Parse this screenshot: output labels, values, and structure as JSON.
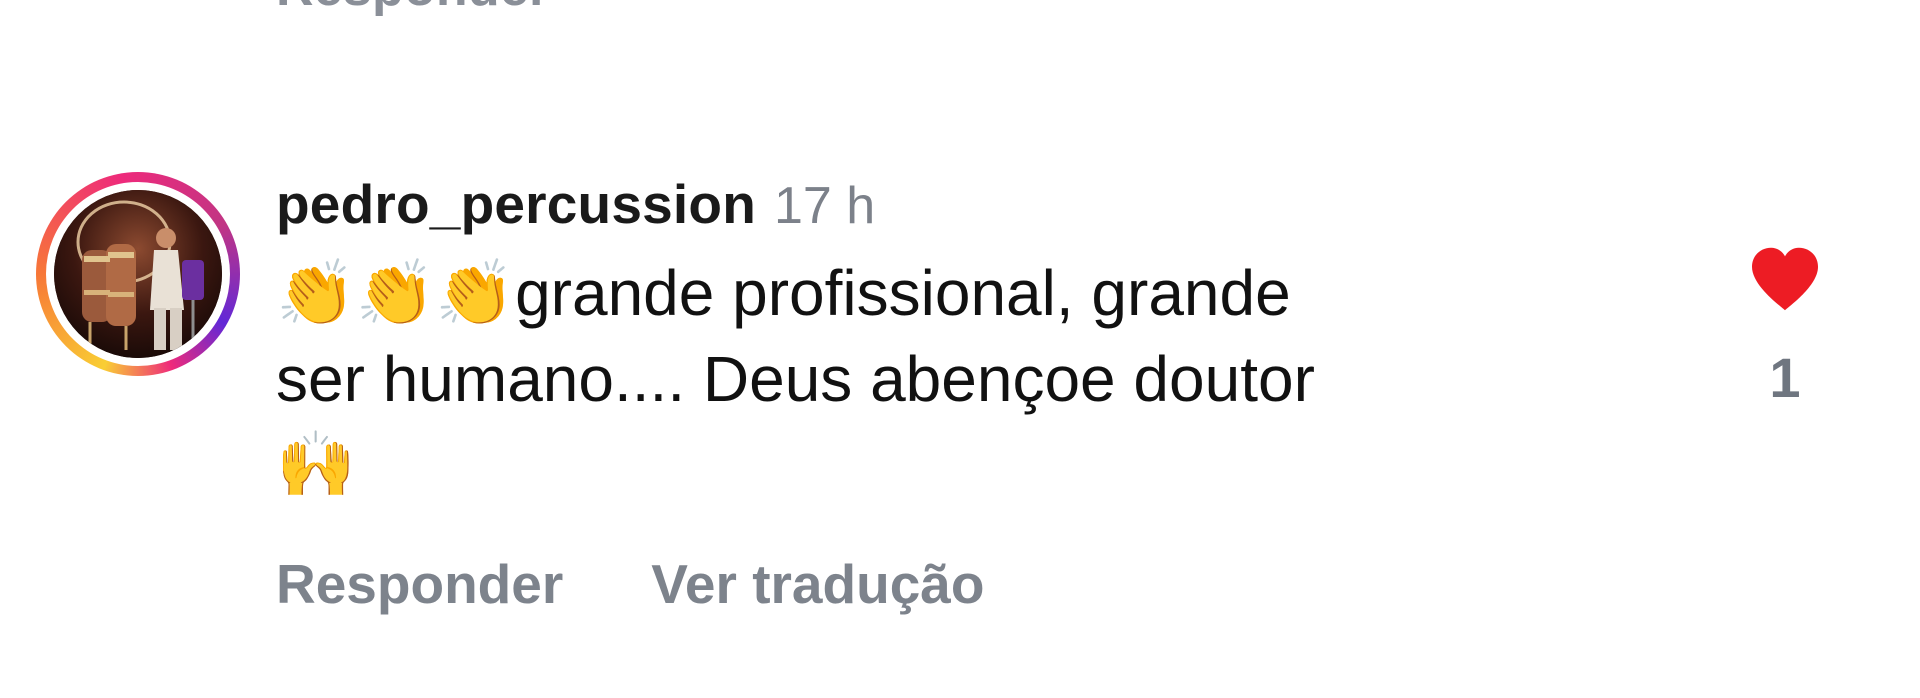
{
  "previous_comment": {
    "reply_label": "Responder"
  },
  "comment": {
    "username": "pedro_percussion",
    "timestamp": "17 h",
    "text_line_1": "👏👏👏grande profissional, grande",
    "text_line_2": "ser humano.... Deus abençoe doutor",
    "text_line_3": "🙌",
    "actions": {
      "reply": "Responder",
      "translate": "Ver tradução"
    },
    "likes": {
      "count": "1",
      "liked": true
    },
    "avatar": {
      "icon": "musician-on-stage-photo"
    }
  },
  "colors": {
    "heart": "#ed1c24",
    "secondary_text": "#7d838c",
    "story_ring": [
      "#f9ce34",
      "#ee2a7b",
      "#6228d7"
    ]
  }
}
